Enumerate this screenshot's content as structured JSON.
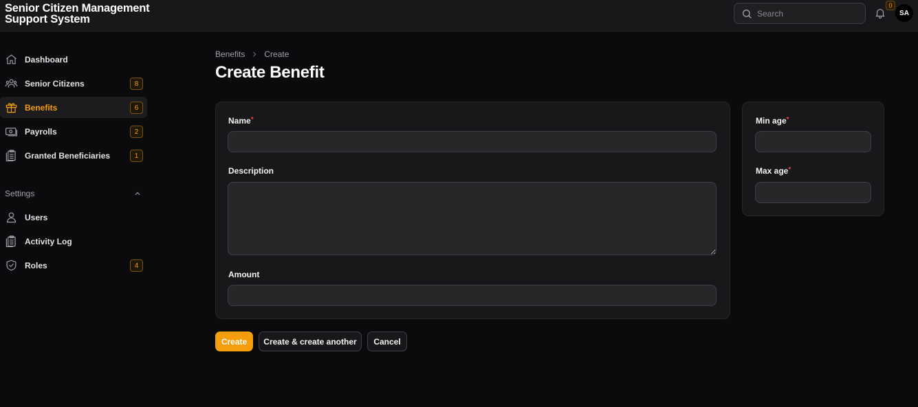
{
  "app": {
    "title_line1": "Senior Citizen Management",
    "title_line2": "Support System"
  },
  "topbar": {
    "search_placeholder": "Search",
    "notifications_count": "0",
    "avatar_initials": "SA"
  },
  "sidebar": {
    "items": [
      {
        "label": "Dashboard",
        "icon": "home-icon",
        "badge": ""
      },
      {
        "label": "Senior Citizens",
        "icon": "users-icon",
        "badge": "8"
      },
      {
        "label": "Benefits",
        "icon": "gift-icon",
        "badge": "6",
        "active": true
      },
      {
        "label": "Payrolls",
        "icon": "banknote-icon",
        "badge": "2"
      },
      {
        "label": "Granted Beneficiaries",
        "icon": "clipboard-icon",
        "badge": "1"
      }
    ],
    "group_label": "Settings",
    "settings_items": [
      {
        "label": "Users",
        "icon": "user-icon",
        "badge": ""
      },
      {
        "label": "Activity Log",
        "icon": "clipboard-icon",
        "badge": ""
      },
      {
        "label": "Roles",
        "icon": "shield-check-icon",
        "badge": "4"
      }
    ]
  },
  "breadcrumb": {
    "parent": "Benefits",
    "current": "Create"
  },
  "page": {
    "title": "Create Benefit"
  },
  "form": {
    "name_label": "Name",
    "description_label": "Description",
    "amount_label": "Amount",
    "min_age_label": "Min age",
    "max_age_label": "Max age",
    "required_mark": "*"
  },
  "actions": {
    "create": "Create",
    "create_another": "Create & create another",
    "cancel": "Cancel"
  },
  "colors": {
    "accent": "#f59e0b",
    "background": "#0b0a0c",
    "surface": "#18181b",
    "required": "#ef4444"
  }
}
